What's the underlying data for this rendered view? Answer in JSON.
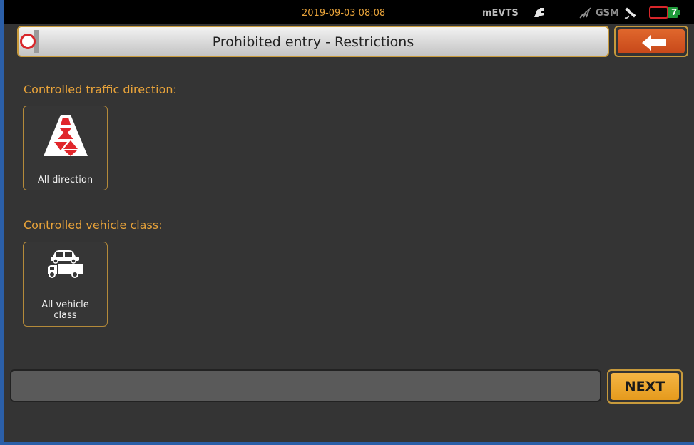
{
  "status_bar": {
    "datetime": "2019-09-03 08:08",
    "app_name": "mEVTS",
    "network": "GSM",
    "icons": [
      "hand-device-icon",
      "no-signal-icon",
      "satellite-icon",
      "battery-icon"
    ],
    "battery_level_label": "7",
    "colors": {
      "accent": "#e8a33a",
      "battery_warn": "#d8262a",
      "battery_ok": "#1f9a3a"
    }
  },
  "header": {
    "title": "Prohibited entry - Restrictions",
    "recording_indicator_color": "#d8262a",
    "back_icon": "arrow-left-icon"
  },
  "sections": {
    "direction": {
      "label": "Controlled traffic direction:",
      "tile_label": "All direction",
      "icon": "road-all-direction-icon"
    },
    "vehicle": {
      "label": "Controlled vehicle class:",
      "tile_label": "All vehicle class",
      "icon": "car-truck-icon"
    }
  },
  "footer": {
    "next_label": "NEXT"
  },
  "colors": {
    "background": "#343434",
    "accent": "#e8a33a",
    "back_button": "#d4551f",
    "next_button": "#f0a830"
  }
}
